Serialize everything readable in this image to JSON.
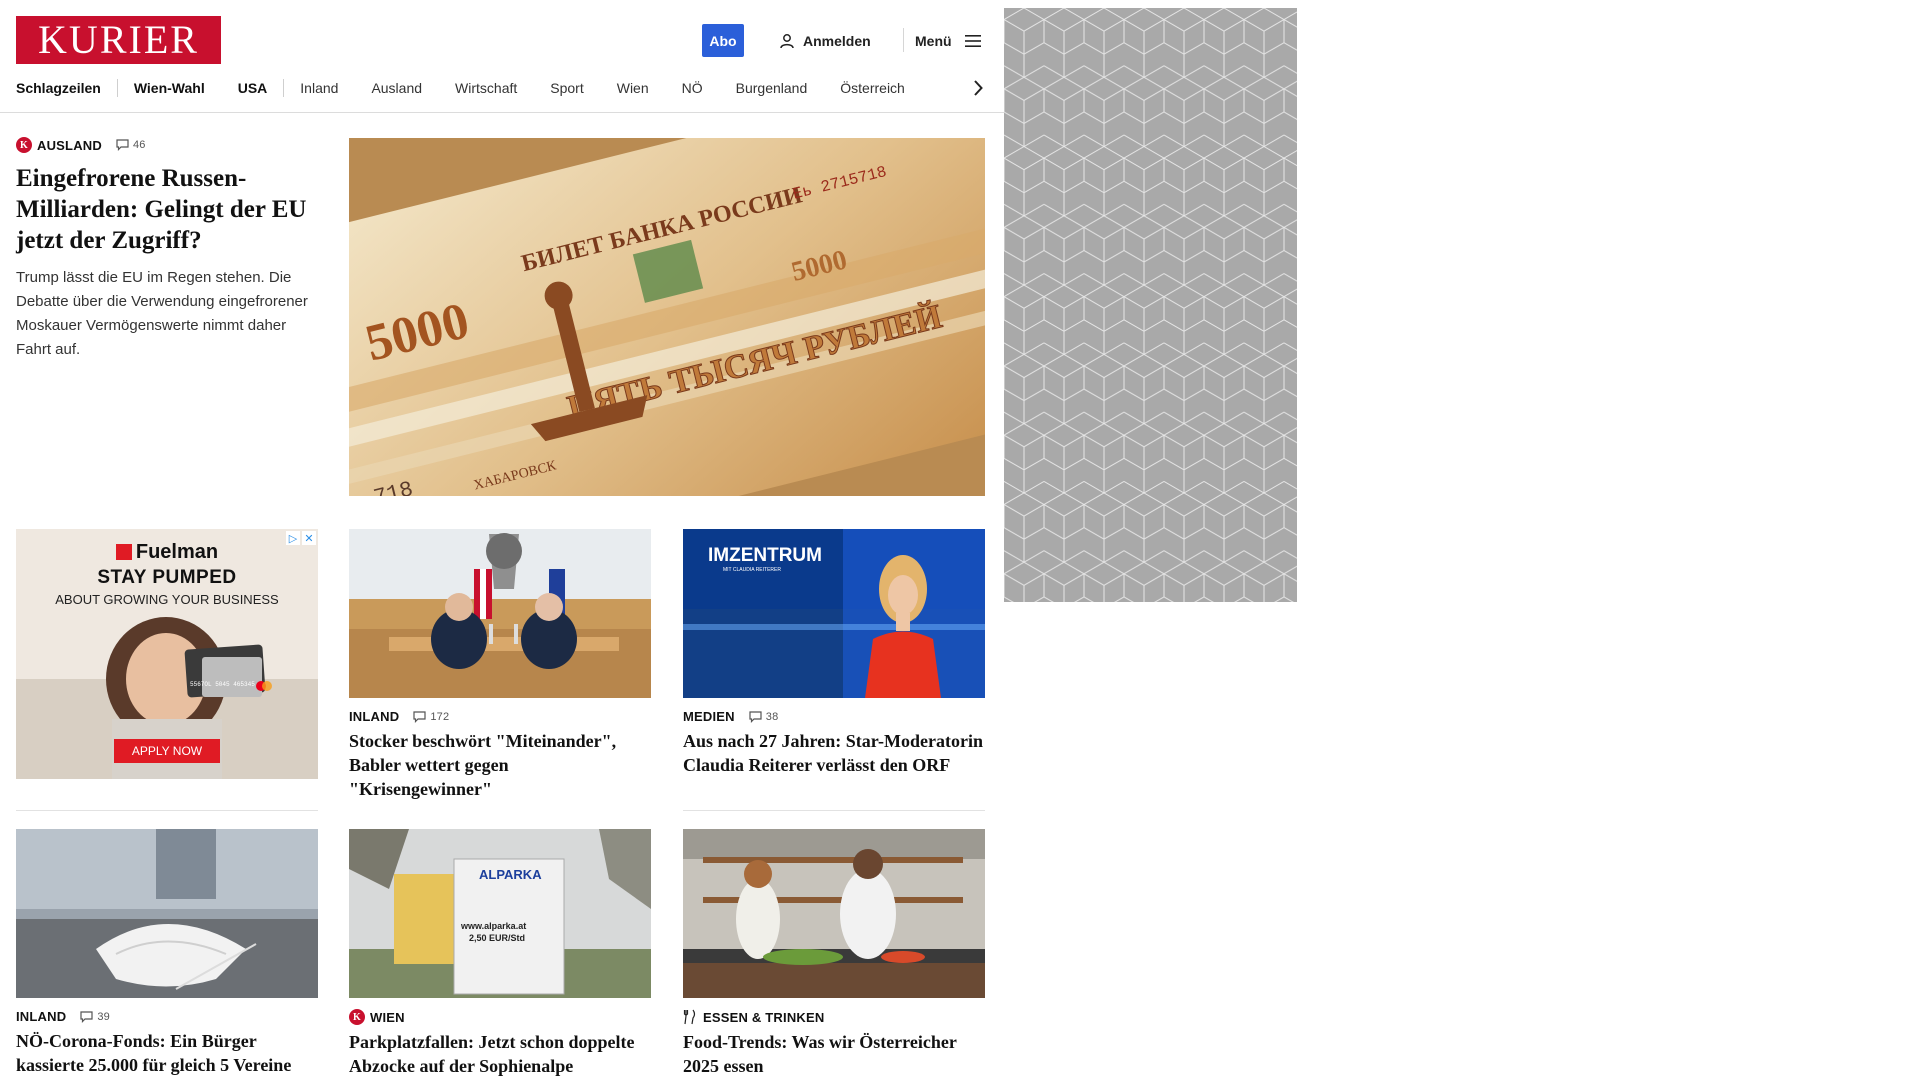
{
  "header": {
    "logo": "KURIER",
    "abo_label": "Abo",
    "login_label": "Anmelden",
    "menu_label": "Menü",
    "colors": {
      "brand": "#c8102e",
      "abo": "#2b5fd9"
    }
  },
  "nav": {
    "items": [
      "Schlagzeilen",
      "Wien-Wahl",
      "USA",
      "Inland",
      "Ausland",
      "Wirtschaft",
      "Sport",
      "Wien",
      "NÖ",
      "Burgenland",
      "Österreich"
    ]
  },
  "hero": {
    "kicker": "AUSLAND",
    "comments": "46",
    "title": "Eingefrorene Russen-Milliarden: Gelingt der EU jetzt der Zugriff?",
    "lead": "Trump lässt die EU im Regen stehen. Die Debatte über die Verwendung eingefrorener Moskauer Vermögenswerte nimmt daher Fahrt auf.",
    "image": {
      "banknote_text": "ПЯТЬ ТЫСЯЧ РУБЛЕЙ",
      "banknote_header": "БИЛЕТ БАНКА РОССИИ",
      "denomination": "5000",
      "serial": "Еь 2715718",
      "city": "ХАБАРОВСК",
      "number_fragment": "718"
    }
  },
  "ad": {
    "brand": "Fuelman",
    "headline": "STAY PUMPED",
    "sub": "ABOUT GROWING YOUR BUSINESS",
    "cta": "APPLY NOW",
    "card_number": "5567OL 5045 465345"
  },
  "cards": [
    {
      "kicker": "INLAND",
      "comments": "172",
      "title": "Stocker beschwört \"Miteinander\", Babler wettert gegen \"Krisengewinner\""
    },
    {
      "kicker": "MEDIEN",
      "comments": "38",
      "title": "Aus nach 27 Jahren: Star-Moderatorin Claudia Reiterer verlässt den ORF",
      "image_logo": "IMZENTRUM",
      "image_logo_sub": "MIT CLAUDIA REITERER"
    },
    {
      "kicker": "INLAND",
      "comments": "39",
      "title": "NÖ-Corona-Fonds: Ein Bürger kassierte 25.000 für gleich 5 Vereine"
    },
    {
      "kicker": "WIEN",
      "title": "Parkplatzfallen: Jetzt schon doppelte Abzocke auf der Sophienalpe",
      "sign_brand": "ALPARKA",
      "sign_url": "www.alparka.at",
      "sign_price": "2,50 EUR/Std"
    },
    {
      "kicker": "ESSEN & TRINKEN",
      "title": "Food-Trends: Was wir Österreicher 2025 essen"
    }
  ]
}
